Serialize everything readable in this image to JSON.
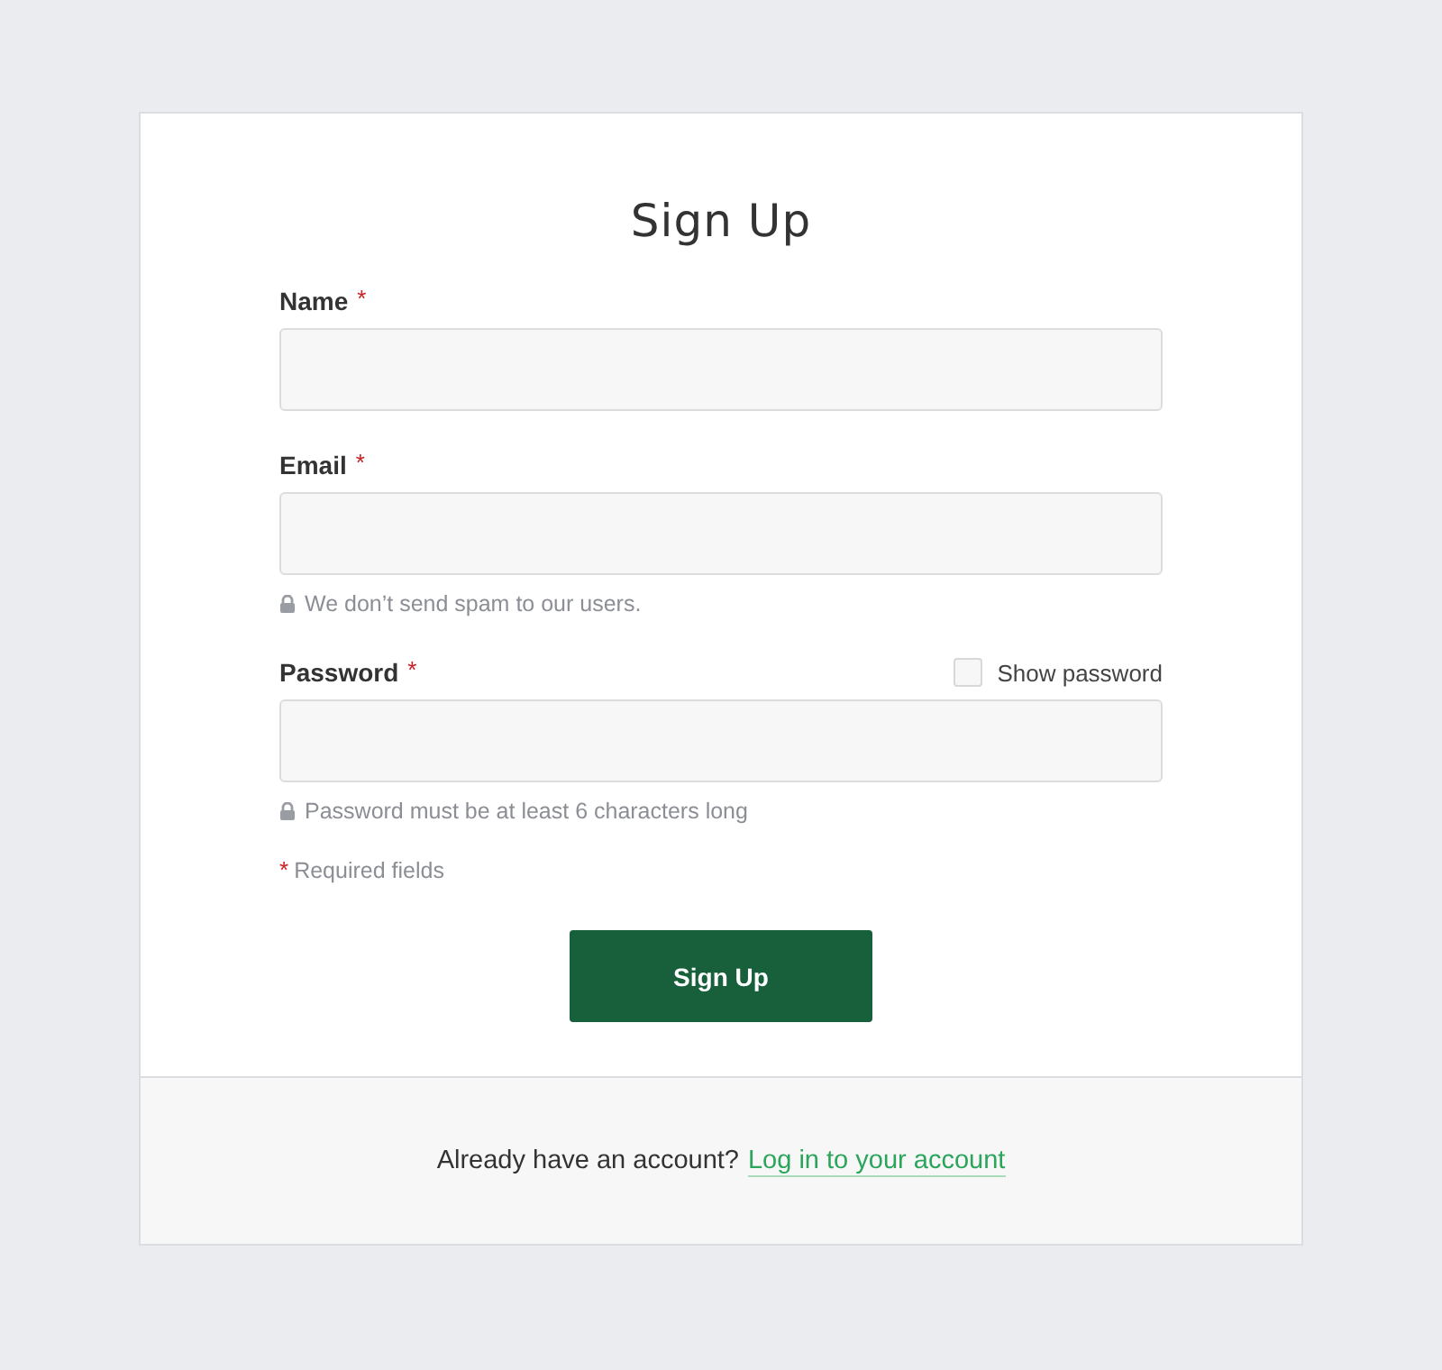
{
  "title": "Sign Up",
  "fields": [
    {
      "label": "Name",
      "required_mark": "*"
    },
    {
      "label": "Email",
      "required_mark": "*",
      "hint": "We don’t send spam to our users."
    },
    {
      "label": "Password",
      "required_mark": "*",
      "hint": "Password must be at least 6 characters long",
      "show_password": {
        "label": "Show password",
        "checked": false
      }
    }
  ],
  "required_note": {
    "mark": "*",
    "text": "Required fields"
  },
  "submit": "Sign Up",
  "footer": {
    "text": "Already have an account?",
    "link": "Log in to your account"
  }
}
